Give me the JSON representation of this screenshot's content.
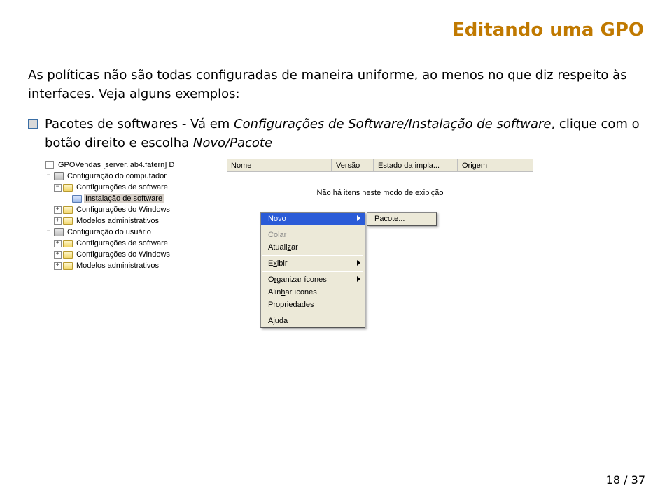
{
  "title": "Editando uma GPO",
  "intro": "As políticas não são todas configuradas de maneira uniforme, ao menos no que diz respeito às interfaces. Veja alguns exemplos:",
  "bullet_prefix": "Pacotes de softwares - Vá em ",
  "bullet_em1": "Configurações de Software/Instalação de software",
  "bullet_mid": ", clique com o botão direito e escolha ",
  "bullet_em2": "Novo/Pacote",
  "tree": {
    "root": "GPOVendas [server.lab4.fatern] D",
    "comp_cfg": "Configuração do computador",
    "comp_sw": "Configurações de software",
    "inst_sw": "Instalação de software",
    "comp_win": "Configurações do Windows",
    "comp_adm": "Modelos administrativos",
    "user_cfg": "Configuração do usuário",
    "user_sw": "Configurações de software",
    "user_win": "Configurações do Windows",
    "user_adm": "Modelos administrativos"
  },
  "cols": {
    "nome": "Nome",
    "versao": "Versão",
    "estado": "Estado da impla...",
    "origem": "Origem"
  },
  "empty": "Não há itens neste modo de exibição",
  "ctx": {
    "novo": "Novo",
    "colar": "Colar",
    "atualizar": "Atualizar",
    "exibir": "Exibir",
    "organizar": "Organizar ícones",
    "alinhar": "Alinhar ícones",
    "propriedades": "Propriedades",
    "ajuda": "Ajuda",
    "pacote": "Pacote..."
  },
  "pagenum": "18 / 37"
}
